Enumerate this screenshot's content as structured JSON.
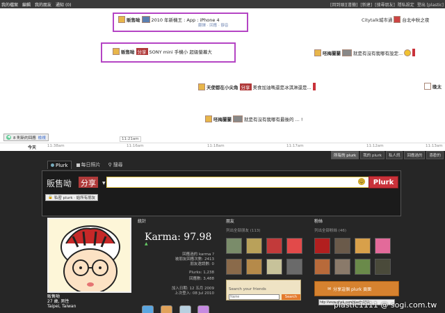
{
  "topbar": {
    "left": [
      "我的檔案",
      "編輯",
      "我的朋友",
      "通知 (0)"
    ],
    "right": [
      "[回到頭][書籤]",
      "[新建]",
      "[搜尋朋友]",
      "隱私設定",
      "登出 [plastic]"
    ]
  },
  "timeline": {
    "plurks": [
      {
        "name": "販售呦",
        "qualifier": "",
        "text": "2010 年新機王 : App : iPhone 4",
        "sub": "翻譯 · 回應 · 靜音"
      },
      {
        "name": "販售呦",
        "qualifier": "分享",
        "text": "SONY mini 手機小 超級螢幕大",
        "sub": ""
      },
      {
        "name": "Citytalk城市通",
        "qualifier": "",
        "text": "台北中秋之夜",
        "sub": ""
      },
      {
        "name": "呸梅蘭蘭",
        "qualifier": "",
        "text": "就是有沒有我哪有設定...",
        "sub": ""
      },
      {
        "name": "天使都在小尖角",
        "qualifier": "分享",
        "text": "美食加油嗎還是冰淇淋還是...",
        "sub": ""
      },
      {
        "name": "晚太",
        "qualifier": "",
        "text": "",
        "sub": ""
      },
      {
        "name": "呸梅蘭蘭",
        "qualifier": "",
        "text": "就是有沒有我哪有最後的 ... !",
        "sub": ""
      }
    ],
    "new_marker": "8 則新的回應",
    "new_marker_link": "檢視",
    "cursor_time": "11:21am"
  },
  "axis": {
    "today": "今天",
    "ticks": [
      "11:38am",
      "11:16am",
      "11:18am",
      "11:17am",
      "11:12am",
      "11:13am"
    ]
  },
  "filters": [
    "所有的 plurk",
    "我的 plurk",
    "私人訊",
    "回應過的",
    "喜歡的"
  ],
  "filters_active": 0,
  "tabs": [
    {
      "label": "Plurk",
      "active": true,
      "icon": "plurk-dot-icon"
    },
    {
      "label": "每日照片",
      "active": false,
      "icon": "photo-icon"
    },
    {
      "label": "搜尋",
      "active": false,
      "icon": "search-icon"
    }
  ],
  "composer": {
    "nickname": "販售呦",
    "qualifier": "分享",
    "input_value": "",
    "plurk_button": "Plurk",
    "option": "私密 plurk · 給所有朋友"
  },
  "profile": {
    "name": "販售呦",
    "age_gender": "27 歲, 男性",
    "location": "Taipei, Taiwan"
  },
  "stats": {
    "header": "統計",
    "karma_label": "Karma:",
    "karma_value": "97.98",
    "rows": [
      {
        "label": "回應過的",
        "value": "karma ?"
      },
      {
        "label": "被朋友回應次數:",
        "value": "2413"
      },
      {
        "label": "朋友邀請數:",
        "value": "0"
      },
      {
        "label": "Plurks:",
        "value": "1,238"
      },
      {
        "label": "回應數:",
        "value": "3,488"
      },
      {
        "label": "加入日期:",
        "value": "12 五月 2009"
      },
      {
        "label": "上次登入:",
        "value": "08 Jul 2010"
      }
    ]
  },
  "friends": {
    "header": "朋友",
    "link": "列出全部朋友 (113)",
    "thumb_colors": [
      "#7a8c6a",
      "#b9a15a",
      "#c23a3a",
      "#e24a4a",
      "#8a6a4a",
      "#b58a4a",
      "#c7c29a",
      "#6a6a6a"
    ]
  },
  "fans": {
    "header": "粉絲",
    "link": "列出全部粉絲 (46)",
    "thumb_colors": [
      "#b21f1f",
      "#6a5a4a",
      "#d8a04a",
      "#e36a9a",
      "#b86a3a",
      "#8a7a6a",
      "#6a8a4a",
      "#4a4a3a"
    ]
  },
  "search": {
    "title": "Search your friends",
    "placeholder": "Name",
    "button": "Search"
  },
  "share": {
    "label": "分享這個 plurk 頁面",
    "url": "http://www.plurk.com/plastic1111"
  },
  "watermark": {
    "user": "plastic1111",
    "site": "@ sogi.com.tw"
  },
  "colors": {
    "highlight": "#b444c4",
    "plurk_red": "#c9323a",
    "qualifier_red": "#b03a3a",
    "share_orange": "#d6822f"
  }
}
